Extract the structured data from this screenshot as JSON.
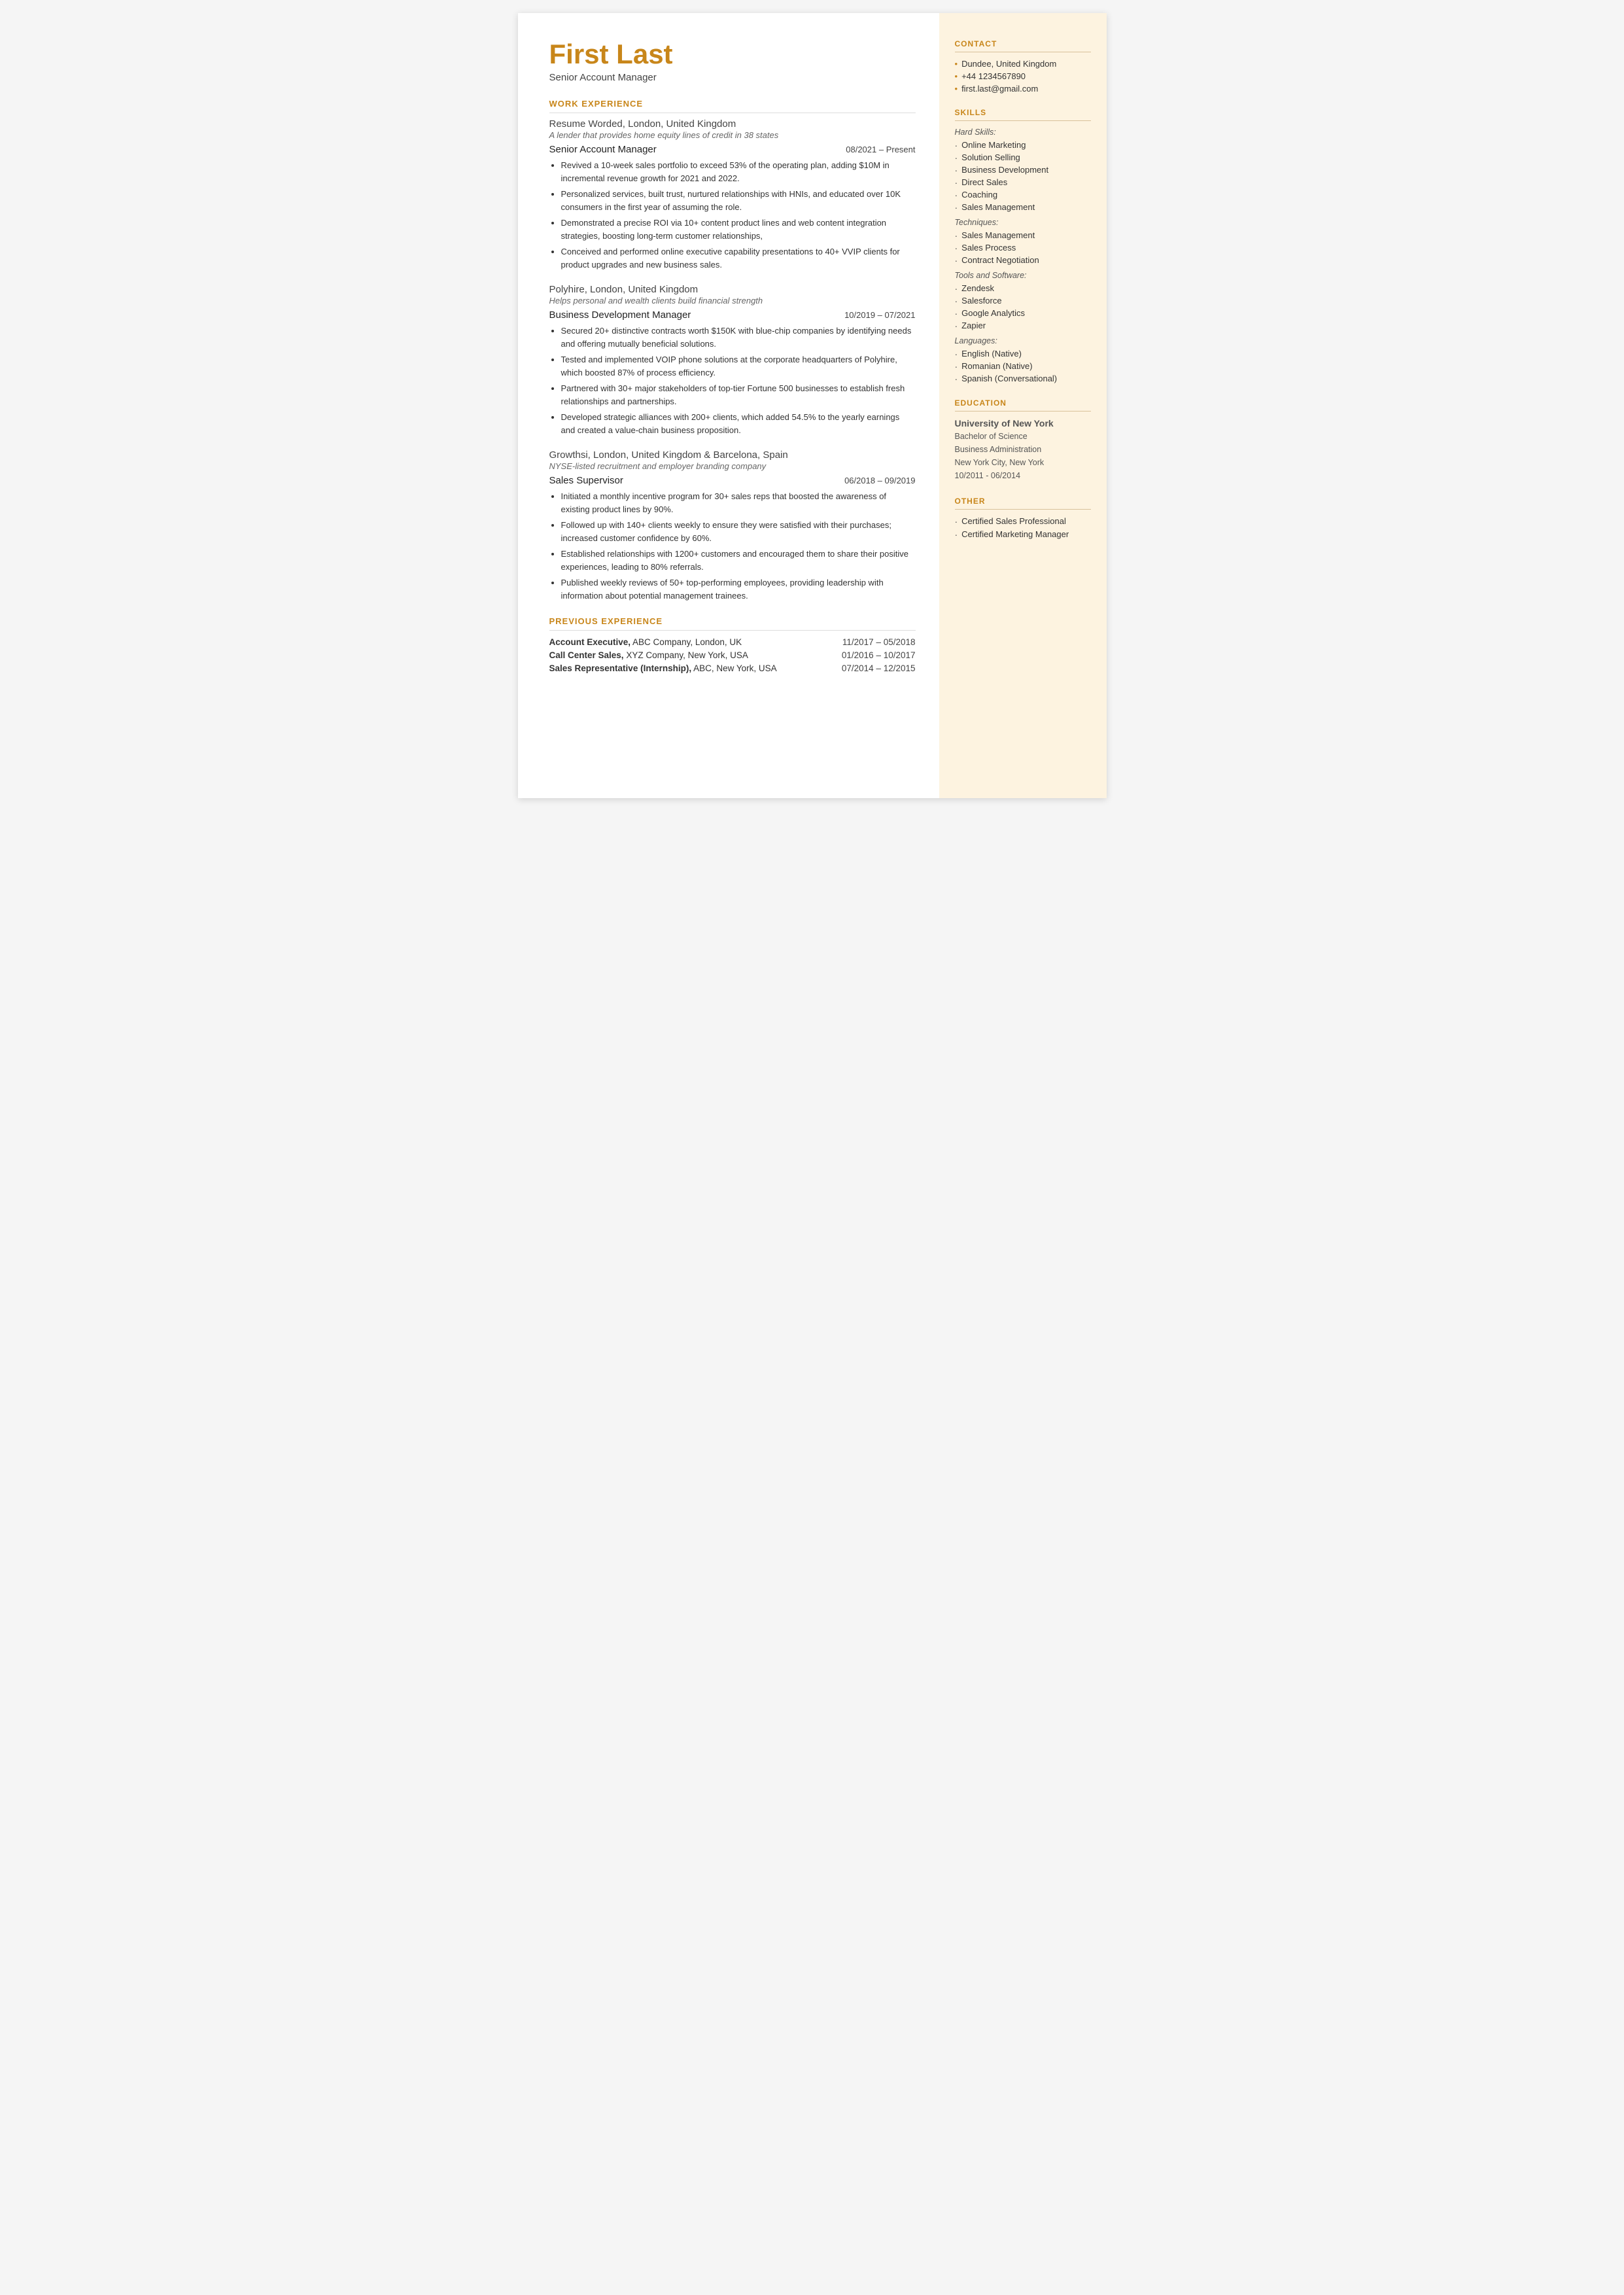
{
  "header": {
    "name": "First Last",
    "title": "Senior Account Manager"
  },
  "sections": {
    "work_experience_label": "WORK EXPERIENCE",
    "previous_experience_label": "PREVIOUS EXPERIENCE"
  },
  "jobs": [
    {
      "company": "Resume Worded,",
      "company_rest": " London, United Kingdom",
      "tagline": "A lender that provides home equity lines of credit in 38 states",
      "role": "Senior Account Manager",
      "dates": "08/2021 – Present",
      "bullets": [
        "Revived a 10-week sales portfolio to exceed 53% of the operating plan, adding $10M in incremental revenue growth for 2021 and 2022.",
        "Personalized services, built trust, nurtured relationships with HNIs, and educated over 10K consumers in the first year of assuming the role.",
        "Demonstrated a precise ROI via 10+ content product lines and web content integration strategies, boosting long-term customer relationships,",
        "Conceived and performed online executive capability presentations to 40+ VVIP clients for product upgrades and new business sales."
      ]
    },
    {
      "company": "Polyhire,",
      "company_rest": " London, United Kingdom",
      "tagline": "Helps personal and wealth clients build financial strength",
      "role": "Business Development Manager",
      "dates": "10/2019 – 07/2021",
      "bullets": [
        "Secured 20+ distinctive contracts worth $150K with blue-chip companies by identifying needs and offering mutually beneficial solutions.",
        "Tested and implemented VOIP phone solutions at the corporate headquarters of Polyhire, which boosted 87% of process efficiency.",
        "Partnered with 30+ major stakeholders of top-tier Fortune 500 businesses to establish fresh relationships and partnerships.",
        "Developed strategic alliances with 200+ clients, which added 54.5% to the yearly earnings and created a value-chain business proposition."
      ]
    },
    {
      "company": "Growthsi,",
      "company_rest": " London, United Kingdom & Barcelona, Spain",
      "tagline": "NYSE-listed recruitment and employer branding company",
      "role": "Sales Supervisor",
      "dates": "06/2018 – 09/2019",
      "bullets": [
        "Initiated a monthly incentive program for 30+ sales reps that boosted the awareness of existing product lines by 90%.",
        "Followed up with 140+ clients weekly to ensure they were satisfied with their purchases; increased customer confidence by 60%.",
        "Established relationships with 1200+ customers and encouraged them to share their positive experiences, leading to 80% referrals.",
        "Published weekly reviews of 50+ top-performing employees, providing leadership with information about potential management trainees."
      ]
    }
  ],
  "previous_experience": [
    {
      "label": "Account Executive,",
      "rest": " ABC Company, London, UK",
      "dates": "11/2017 – 05/2018"
    },
    {
      "label": "Call Center Sales,",
      "rest": " XYZ Company, New York, USA",
      "dates": "01/2016 – 10/2017"
    },
    {
      "label": "Sales Representative (Internship),",
      "rest": " ABC, New York, USA",
      "dates": "07/2014 – 12/2015"
    }
  ],
  "sidebar": {
    "contact_label": "CONTACT",
    "contact": [
      "Dundee, United Kingdom",
      "+44 1234567890",
      "first.last@gmail.com"
    ],
    "skills_label": "SKILLS",
    "hard_skills_label": "Hard Skills:",
    "hard_skills": [
      "Online Marketing",
      "Solution Selling",
      "Business Development",
      "Direct Sales",
      "Coaching",
      "Sales Management"
    ],
    "techniques_label": "Techniques:",
    "techniques": [
      "Sales Management",
      "Sales Process",
      "Contract Negotiation"
    ],
    "tools_label": "Tools and Software:",
    "tools": [
      "Zendesk",
      "Salesforce",
      "Google Analytics",
      "Zapier"
    ],
    "languages_label": "Languages:",
    "languages": [
      "English (Native)",
      "Romanian (Native)",
      "Spanish (Conversational)"
    ],
    "education_label": "EDUCATION",
    "education": {
      "school": "University of New York",
      "degree": "Bachelor of Science",
      "field": "Business Administration",
      "location": "New York City, New York",
      "dates": "10/2011 - 06/2014"
    },
    "other_label": "OTHER",
    "other": [
      "Certified Sales Professional",
      "Certified Marketing Manager"
    ]
  }
}
